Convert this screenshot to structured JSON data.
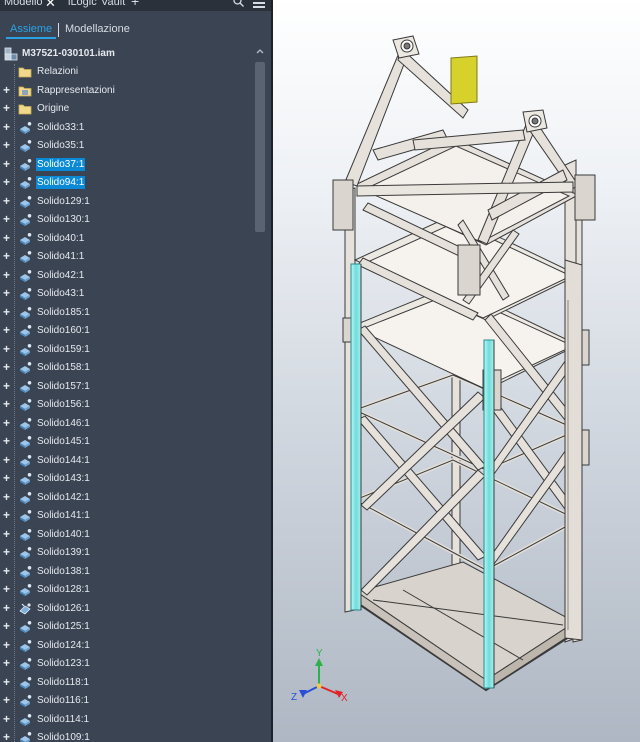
{
  "tabs": {
    "items": [
      {
        "label": "Modello"
      },
      {
        "label": "iLogic"
      },
      {
        "label": "Vault"
      }
    ],
    "close_glyph": "✕",
    "add_glyph": "+"
  },
  "subtabs": {
    "assieme": "Assieme",
    "modellazione": "Modellazione"
  },
  "tree": {
    "root": "M37521-030101.iam",
    "items": [
      {
        "label": "Relazioni",
        "icon": "folder-icon",
        "expandable": false,
        "selected": false
      },
      {
        "label": "Rappresentazioni",
        "icon": "representations-icon",
        "expandable": true,
        "selected": false
      },
      {
        "label": "Origine",
        "icon": "folder-icon",
        "expandable": true,
        "selected": false
      },
      {
        "label": "Solido33:1",
        "icon": "part-icon",
        "expandable": true,
        "selected": false
      },
      {
        "label": "Solido35:1",
        "icon": "part-icon",
        "expandable": true,
        "selected": false
      },
      {
        "label": "Solido37:1",
        "icon": "part-icon",
        "expandable": true,
        "selected": true
      },
      {
        "label": "Solido94:1",
        "icon": "part-icon",
        "expandable": true,
        "selected": true
      },
      {
        "label": "Solido129:1",
        "icon": "part-icon",
        "expandable": true,
        "selected": false
      },
      {
        "label": "Solido130:1",
        "icon": "part-icon",
        "expandable": true,
        "selected": false
      },
      {
        "label": "Solido40:1",
        "icon": "part-icon",
        "expandable": true,
        "selected": false
      },
      {
        "label": "Solido41:1",
        "icon": "part-icon",
        "expandable": true,
        "selected": false
      },
      {
        "label": "Solido42:1",
        "icon": "part-icon",
        "expandable": true,
        "selected": false
      },
      {
        "label": "Solido43:1",
        "icon": "part-icon",
        "expandable": true,
        "selected": false
      },
      {
        "label": "Solido185:1",
        "icon": "part-icon",
        "expandable": true,
        "selected": false
      },
      {
        "label": "Solido160:1",
        "icon": "part-icon",
        "expandable": true,
        "selected": false
      },
      {
        "label": "Solido159:1",
        "icon": "part-icon",
        "expandable": true,
        "selected": false
      },
      {
        "label": "Solido158:1",
        "icon": "part-icon",
        "expandable": true,
        "selected": false
      },
      {
        "label": "Solido157:1",
        "icon": "part-icon",
        "expandable": true,
        "selected": false
      },
      {
        "label": "Solido156:1",
        "icon": "part-icon",
        "expandable": true,
        "selected": false
      },
      {
        "label": "Solido146:1",
        "icon": "part-icon",
        "expandable": true,
        "selected": false
      },
      {
        "label": "Solido145:1",
        "icon": "part-icon",
        "expandable": true,
        "selected": false
      },
      {
        "label": "Solido144:1",
        "icon": "part-icon",
        "expandable": true,
        "selected": false
      },
      {
        "label": "Solido143:1",
        "icon": "part-icon",
        "expandable": true,
        "selected": false
      },
      {
        "label": "Solido142:1",
        "icon": "part-icon",
        "expandable": true,
        "selected": false
      },
      {
        "label": "Solido141:1",
        "icon": "part-icon",
        "expandable": true,
        "selected": false
      },
      {
        "label": "Solido140:1",
        "icon": "part-icon",
        "expandable": true,
        "selected": false
      },
      {
        "label": "Solido139:1",
        "icon": "part-icon",
        "expandable": true,
        "selected": false
      },
      {
        "label": "Solido138:1",
        "icon": "part-icon",
        "expandable": true,
        "selected": false
      },
      {
        "label": "Solido128:1",
        "icon": "part-icon",
        "expandable": true,
        "selected": false
      },
      {
        "label": "Solido126:1",
        "icon": "part-sketch-icon",
        "expandable": true,
        "selected": false
      },
      {
        "label": "Solido125:1",
        "icon": "part-icon",
        "expandable": true,
        "selected": false
      },
      {
        "label": "Solido124:1",
        "icon": "part-icon",
        "expandable": true,
        "selected": false
      },
      {
        "label": "Solido123:1",
        "icon": "part-icon",
        "expandable": true,
        "selected": false
      },
      {
        "label": "Solido118:1",
        "icon": "part-icon",
        "expandable": true,
        "selected": false
      },
      {
        "label": "Solido116:1",
        "icon": "part-icon",
        "expandable": true,
        "selected": false
      },
      {
        "label": "Solido114:1",
        "icon": "part-icon",
        "expandable": true,
        "selected": false
      },
      {
        "label": "Solido109:1",
        "icon": "part-icon",
        "expandable": true,
        "selected": false
      }
    ]
  },
  "viewcube_axes": {
    "x": "X",
    "y": "Y",
    "z": "Z"
  },
  "colors": {
    "panel_bg": "#3b4453",
    "selection": "#0a8ad6",
    "accent": "#2aa2e3",
    "highlight_members": "#7fe6e6",
    "frame": "#e2ddd7",
    "plate": "#d9d330",
    "axis_x": "#e0242a",
    "axis_y": "#2bb24a",
    "axis_z": "#2a4fd6"
  }
}
